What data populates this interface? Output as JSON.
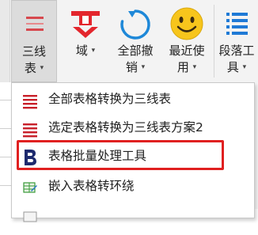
{
  "ribbon": {
    "buttons": [
      {
        "label_line1": "三线",
        "label_line2": "表",
        "icon": "three-line-table-icon",
        "active": true
      },
      {
        "label_line1": "域",
        "label_line2": "",
        "icon": "field-logo-icon"
      },
      {
        "label_line1": "全部撤",
        "label_line2": "销",
        "icon": "undo-circle-icon"
      },
      {
        "label_line1": "最近使",
        "label_line2": "用",
        "icon": "smiley-icon"
      },
      {
        "label_line1": "段落工",
        "label_line2": "具",
        "icon": "list-icon"
      }
    ],
    "arrow": "▾"
  },
  "menu": {
    "items": [
      {
        "label": "全部表格转换为三线表",
        "icon": "red-lines-icon"
      },
      {
        "label": "选定表格转换为三线表方案2",
        "icon": "red-lines-icon"
      },
      {
        "label": "表格批量处理工具",
        "icon": "letter-b-icon",
        "highlighted": true
      },
      {
        "label": "嵌入表格转环绕",
        "icon": "wrap-table-icon"
      },
      {
        "label": "",
        "icon": "partial-icon"
      }
    ]
  },
  "colors": {
    "accent_red": "#e02020",
    "ribbon_bg": "#f3f3f3",
    "menu_red_lines": "#c8202a",
    "b_icon": "#1d2a6e",
    "undo_blue": "#1e88d8",
    "smiley_yellow": "#f7c51c",
    "list_blue": "#1f7ad6"
  }
}
